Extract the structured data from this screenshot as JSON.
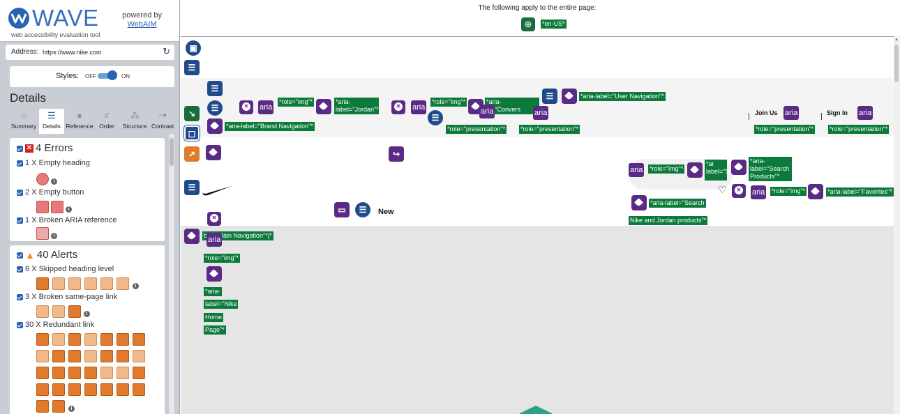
{
  "logo": {
    "name": "WAVE",
    "subtitle": "web accessibility evaluation tool",
    "powered_by": "powered by",
    "webaim": "WebAIM"
  },
  "address": {
    "label": "Address:",
    "value": "https://www.nike.com"
  },
  "styles": {
    "label": "Styles:",
    "off": "OFF",
    "on": "ON"
  },
  "details": {
    "heading": "Details",
    "tabs": [
      "Summary",
      "Details",
      "Reference",
      "Order",
      "Structure",
      "Contrast"
    ],
    "active_tab": "Details"
  },
  "errors": {
    "count_label": "4 Errors",
    "items": [
      {
        "label": "1 X Empty heading"
      },
      {
        "label": "2 X Empty button"
      },
      {
        "label": "1 X Broken ARIA reference"
      }
    ]
  },
  "alerts": {
    "count_label": "40 Alerts",
    "items": [
      {
        "label": "6 X Skipped heading level"
      },
      {
        "label": "3 X Broken same-page link"
      },
      {
        "label": "30 X Redundant link"
      }
    ]
  },
  "page": {
    "note": "The following apply to the entire page:",
    "lang": "*en-US*",
    "labels": {
      "role_img": "*role=\"img\"*",
      "aria_jordan_1": "*aria-",
      "aria_jordan_2": "label=\"Jordan\"*",
      "aria_convers_1": "*aria-",
      "aria_convers_2": "el=\"Convers",
      "user_nav": "*aria-label=\"User Navigation\"*",
      "brand_nav": "*aria-label=\"Brand Navigation\"*",
      "presentation": "*role=\"presentation\"*",
      "join_us": "Join Us",
      "sign_in": "Sign In",
      "search_products_1": "*aria-",
      "search_products_2": "label=\"Search",
      "search_products_3": "Products\"*",
      "label_s": "label=\"S",
      "ar": "*ar",
      "favorites": "*aria-label=\"Favorites\"*",
      "role_img_short": "*role=\"img\"*",
      "search_nike_1": "*aria-label=\"Search",
      "search_nike_2": "Nike and Jordan products\"*",
      "new": "New",
      "main_nav": "bel=\"Main Navigation\"*|*",
      "nike_home_1": "*aria-",
      "nike_home_2": "label=\"Nike",
      "nike_home_3": "Home",
      "nike_home_4": "Page\"*",
      "aria_chip": "aria"
    }
  },
  "colors": {
    "wave_blue": "#2a63b3",
    "error_red": "#d42020",
    "alert_orange": "#e27a2e",
    "aria_purple": "#5b2a86",
    "label_green": "#0b7a3a"
  },
  "icons": {
    "tabs": [
      "home-icon",
      "list-icon",
      "info-icon",
      "order-icon",
      "structure-icon",
      "contrast-icon"
    ]
  }
}
